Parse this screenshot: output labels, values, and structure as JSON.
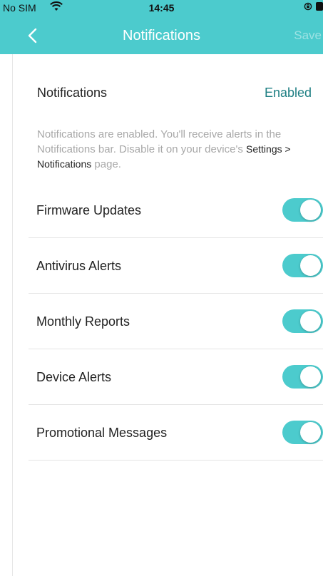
{
  "status_bar": {
    "carrier": "No SIM",
    "time": "14:45",
    "icons": [
      "wifi-icon",
      "orientation-lock-icon",
      "battery-icon"
    ]
  },
  "nav": {
    "back_icon": "chevron-left-icon",
    "title": "Notifications",
    "save_label": "Save"
  },
  "notifications": {
    "label": "Notifications",
    "status": "Enabled"
  },
  "description": {
    "text_before": "Notifications are enabled. You'll receive alerts in the Notifications bar. Disable it on your device's ",
    "link_text": "Settings > Notifications",
    "text_after": " page."
  },
  "settings": [
    {
      "label": "Firmware Updates",
      "enabled": true
    },
    {
      "label": "Antivirus Alerts",
      "enabled": true
    },
    {
      "label": "Monthly Reports",
      "enabled": true
    },
    {
      "label": "Device Alerts",
      "enabled": true
    },
    {
      "label": "Promotional Messages",
      "enabled": true
    }
  ],
  "colors": {
    "accent": "#4ccbcd",
    "status_text": "#1e7f83",
    "muted_text": "#a8a8a8"
  }
}
